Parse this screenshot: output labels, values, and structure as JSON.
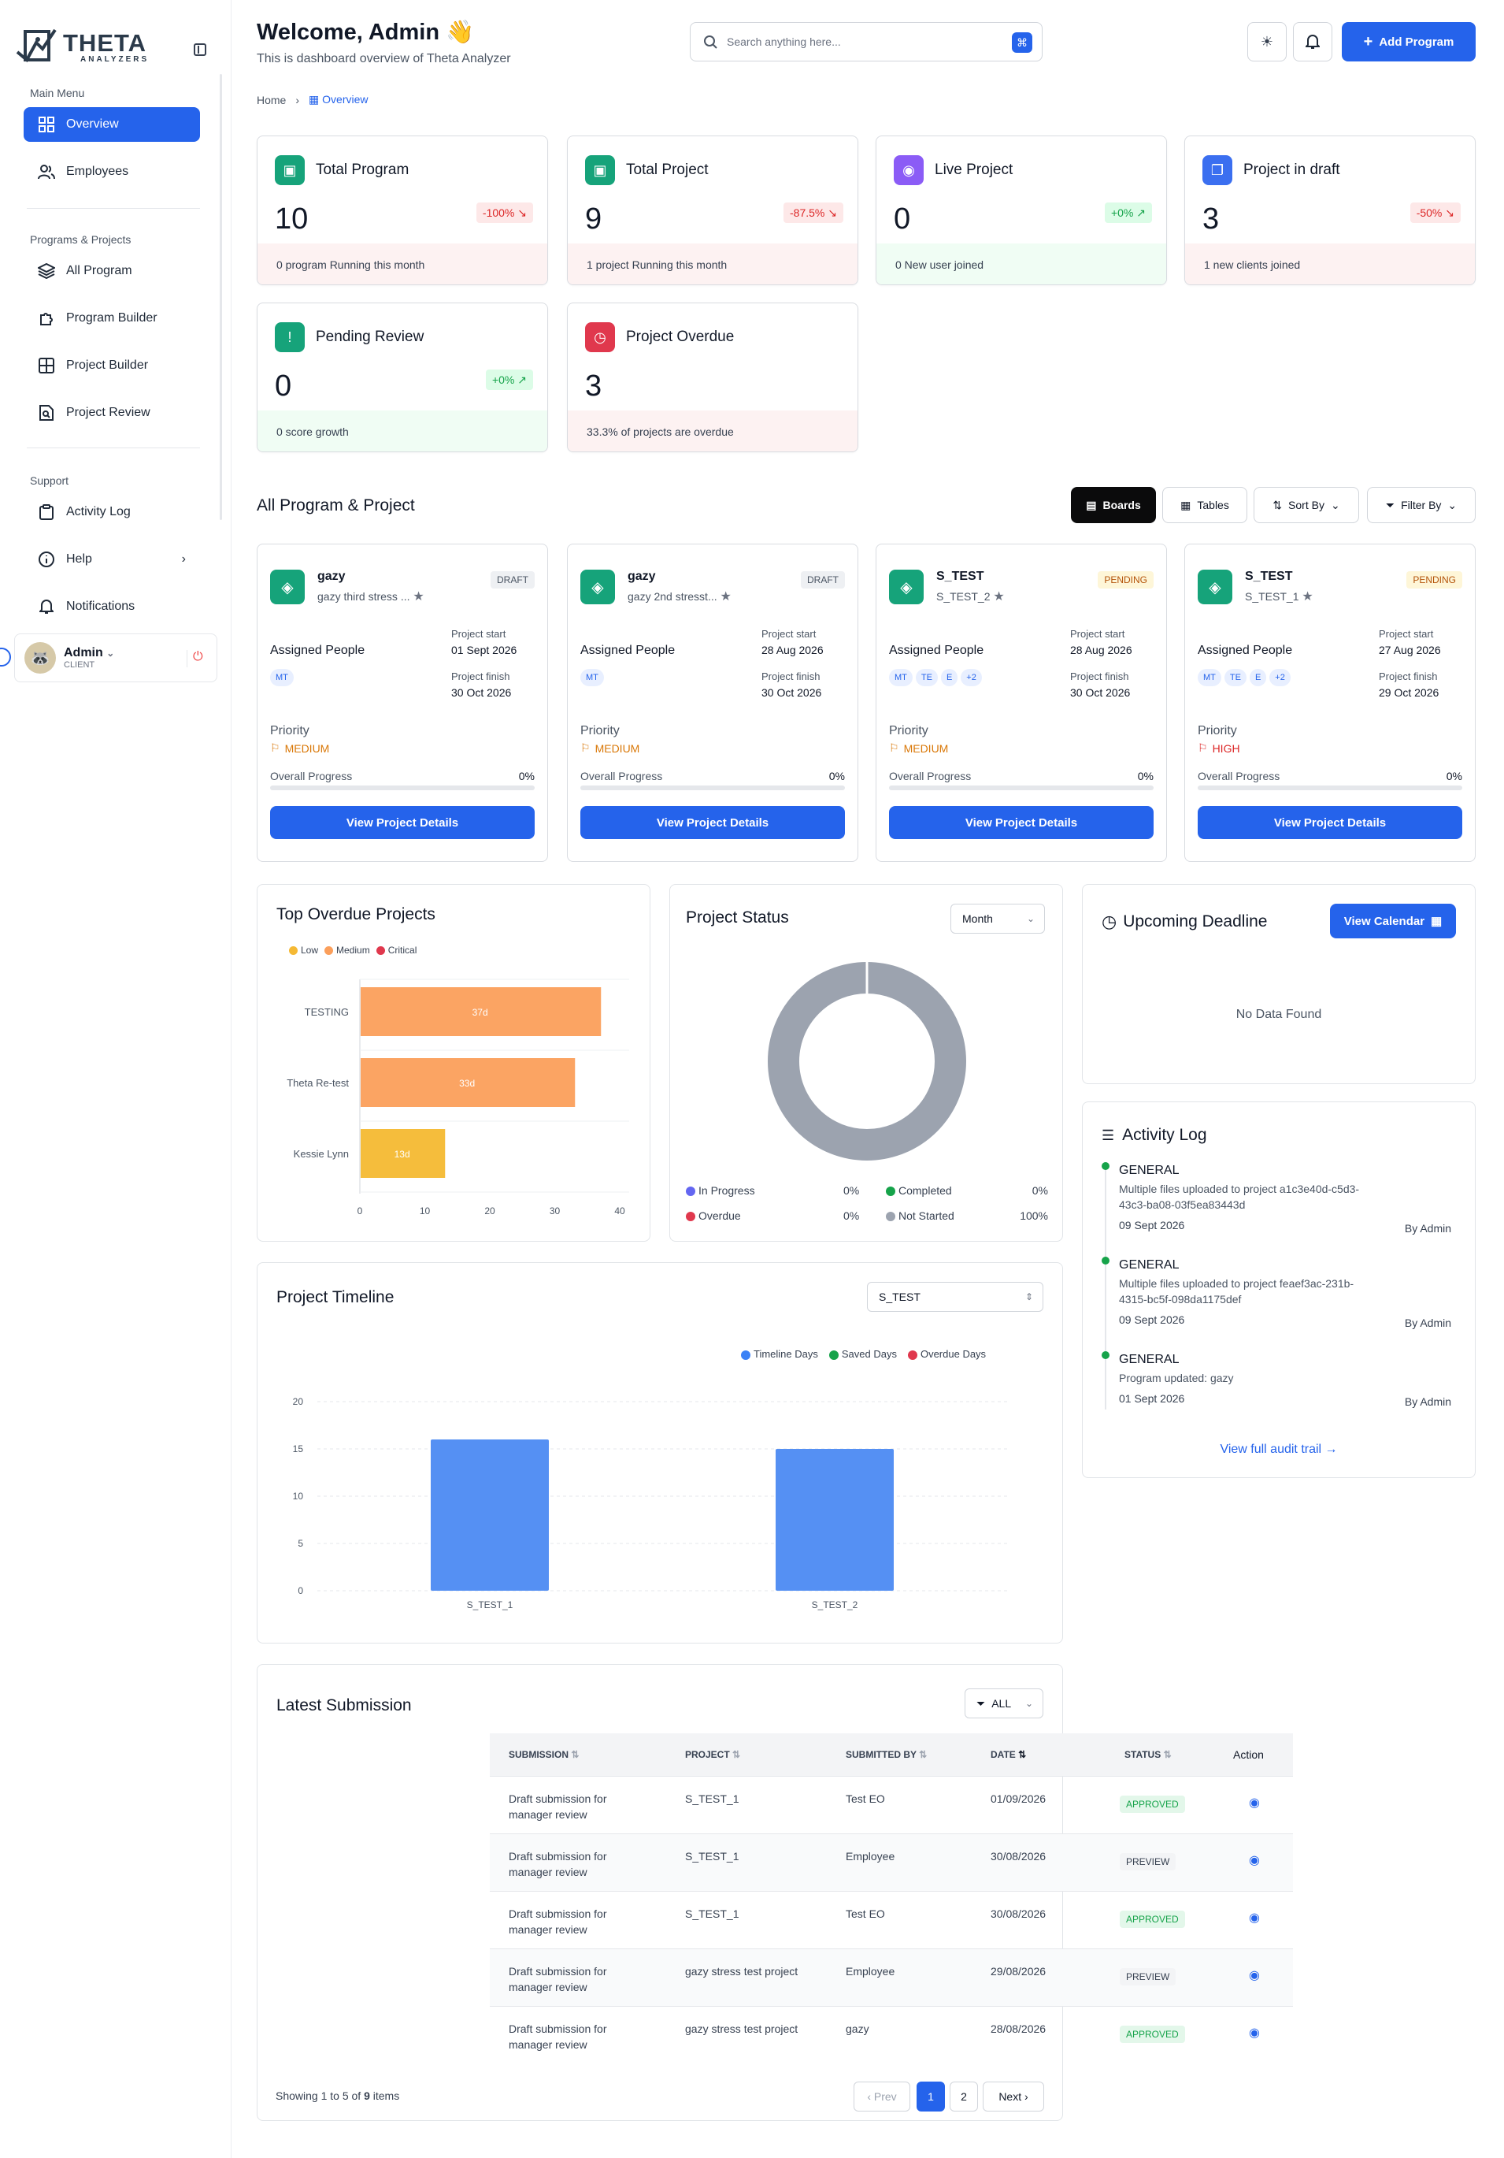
{
  "brand": {
    "name": "THETA",
    "tagline": "ANALYZERS"
  },
  "sidebar": {
    "main_menu_label": "Main Menu",
    "main_items": [
      {
        "label": "Overview",
        "icon": "grid-icon",
        "active": true
      },
      {
        "label": "Employees",
        "icon": "users-icon",
        "active": false
      }
    ],
    "programs_label": "Programs & Projects",
    "program_items": [
      {
        "label": "All Program",
        "icon": "layers-icon"
      },
      {
        "label": "Program Builder",
        "icon": "puzzle-icon"
      },
      {
        "label": "Project Builder",
        "icon": "table-icon"
      },
      {
        "label": "Project Review",
        "icon": "file-search-icon"
      }
    ],
    "support_label": "Support",
    "support_items": [
      {
        "label": "Activity Log",
        "icon": "clipboard-icon"
      },
      {
        "label": "Help",
        "icon": "info-icon"
      },
      {
        "label": "Notifications",
        "icon": "bell-icon"
      }
    ],
    "user": {
      "name": "Admin",
      "role": "CLIENT"
    }
  },
  "header": {
    "title": "Welcome, Admin",
    "title_emoji": "👋",
    "subtitle": "This is dashboard overview of Theta Analyzer",
    "search_placeholder": "Search anything here...",
    "search_shortcut": "⌘",
    "add_button": "Add Program"
  },
  "breadcrumb": {
    "home": "Home",
    "current": "Overview"
  },
  "stats": [
    {
      "title": "Total Program",
      "value": "10",
      "badge": "-100%",
      "trend": "down",
      "footer": "0 program Running this month",
      "icon_color": "#16a37a"
    },
    {
      "title": "Total Project",
      "value": "9",
      "badge": "-87.5%",
      "trend": "down",
      "footer": "1 project Running this month",
      "icon_color": "#16a37a"
    },
    {
      "title": "Live Project",
      "value": "0",
      "badge": "+0%",
      "trend": "up",
      "footer": "0 New user joined",
      "icon_color": "#8b5cf6"
    },
    {
      "title": "Project in draft",
      "value": "3",
      "badge": "-50%",
      "trend": "down",
      "footer": "1 new clients joined",
      "icon_color": "#3b6ff0"
    },
    {
      "title": "Pending Review",
      "value": "0",
      "badge": "+0%",
      "trend": "up",
      "footer": "0 score growth",
      "icon_color": "#16a37a"
    },
    {
      "title": "Project Overdue",
      "value": "3",
      "badge": "",
      "trend": "down",
      "footer": "33.3% of projects are overdue",
      "icon_color": "#e0384d"
    }
  ],
  "programs_section": {
    "title": "All Program & Project",
    "boards": "Boards",
    "tables": "Tables",
    "sort": "Sort By",
    "filter": "Filter By"
  },
  "project_cards": [
    {
      "name": "gazy",
      "desc": "gazy third stress ...",
      "status": "DRAFT",
      "assigned_label": "Assigned People",
      "people": [
        "MT"
      ],
      "start_label": "Project start",
      "start": "01 Sept 2026",
      "finish_label": "Project finish",
      "finish": "30 Oct 2026",
      "priority_label": "Priority",
      "priority": "MEDIUM",
      "progress_label": "Overall Progress",
      "progress": "0%",
      "button": "View Project Details"
    },
    {
      "name": "gazy",
      "desc": "gazy 2nd stresst...",
      "status": "DRAFT",
      "assigned_label": "Assigned People",
      "people": [
        "MT"
      ],
      "start_label": "Project start",
      "start": "28 Aug 2026",
      "finish_label": "Project finish",
      "finish": "30 Oct 2026",
      "priority_label": "Priority",
      "priority": "MEDIUM",
      "progress_label": "Overall Progress",
      "progress": "0%",
      "button": "View Project Details"
    },
    {
      "name": "S_TEST",
      "desc": "S_TEST_2",
      "status": "PENDING",
      "assigned_label": "Assigned People",
      "people": [
        "MT",
        "TE",
        "E",
        "+2"
      ],
      "start_label": "Project start",
      "start": "28 Aug 2026",
      "finish_label": "Project finish",
      "finish": "30 Oct 2026",
      "priority_label": "Priority",
      "priority": "MEDIUM",
      "progress_label": "Overall Progress",
      "progress": "0%",
      "button": "View Project Details"
    },
    {
      "name": "S_TEST",
      "desc": "S_TEST_1",
      "status": "PENDING",
      "assigned_label": "Assigned People",
      "people": [
        "MT",
        "TE",
        "E",
        "+2"
      ],
      "start_label": "Project start",
      "start": "27 Aug 2026",
      "finish_label": "Project finish",
      "finish": "29 Oct 2026",
      "priority_label": "Priority",
      "priority": "HIGH",
      "progress_label": "Overall Progress",
      "progress": "0%",
      "button": "View Project Details"
    }
  ],
  "overdue": {
    "title": "Top Overdue Projects",
    "legend": [
      {
        "label": "Low",
        "color": "#f5b934"
      },
      {
        "label": "Medium",
        "color": "#fb9f5b"
      },
      {
        "label": "Critical",
        "color": "#e0384d"
      }
    ]
  },
  "status_panel": {
    "title": "Project Status",
    "period": "Month",
    "legend": [
      {
        "label": "In Progress",
        "value": "0%",
        "color": "#6366f1"
      },
      {
        "label": "Completed",
        "value": "0%",
        "color": "#16a34a"
      },
      {
        "label": "Overdue",
        "value": "0%",
        "color": "#e0384d"
      },
      {
        "label": "Not Started",
        "value": "100%",
        "color": "#9ca3af"
      }
    ]
  },
  "deadline": {
    "title": "Upcoming Deadline",
    "button": "View Calendar",
    "empty": "No Data Found"
  },
  "activity": {
    "title": "Activity Log",
    "items": [
      {
        "type": "GENERAL",
        "desc": "Multiple files uploaded to project a1c3e40d-c5d3-43c3-ba08-03f5ea83443d",
        "date": "09 Sept 2026",
        "by": "By Admin"
      },
      {
        "type": "GENERAL",
        "desc": "Multiple files uploaded to project feaef3ac-231b-4315-bc5f-098da1175def",
        "date": "09 Sept 2026",
        "by": "By Admin"
      },
      {
        "type": "GENERAL",
        "desc": "Program updated: gazy",
        "date": "01 Sept 2026",
        "by": "By Admin"
      }
    ],
    "link": "View full audit trail"
  },
  "timeline": {
    "title": "Project Timeline",
    "selected": "S_TEST",
    "legend": [
      {
        "label": "Timeline Days",
        "color": "#3b82f6"
      },
      {
        "label": "Saved Days",
        "color": "#16a34a"
      },
      {
        "label": "Overdue Days",
        "color": "#e0384d"
      }
    ]
  },
  "submissions": {
    "title": "Latest Submission",
    "filter": "ALL",
    "columns": [
      "SUBMISSION",
      "PROJECT",
      "SUBMITTED BY",
      "DATE",
      "STATUS",
      "Action"
    ],
    "rows": [
      {
        "submission": "Draft submission for manager review",
        "project": "S_TEST_1",
        "by": "Test EO",
        "date": "01/09/2026",
        "status": "APPROVED"
      },
      {
        "submission": "Draft submission for manager review",
        "project": "S_TEST_1",
        "by": "Employee",
        "date": "30/08/2026",
        "status": "PREVIEW"
      },
      {
        "submission": "Draft submission for manager review",
        "project": "S_TEST_1",
        "by": "Test EO",
        "date": "30/08/2026",
        "status": "APPROVED"
      },
      {
        "submission": "Draft submission for manager review",
        "project": "gazy stress test project",
        "by": "Employee",
        "date": "29/08/2026",
        "status": "PREVIEW"
      },
      {
        "submission": "Draft submission for manager review",
        "project": "gazy stress test project",
        "by": "gazy",
        "date": "28/08/2026",
        "status": "APPROVED"
      }
    ],
    "showing_prefix": "Showing 1 to 5 of",
    "showing_total": "9",
    "showing_suffix": "items",
    "prev": "Prev",
    "pages": [
      "1",
      "2"
    ],
    "next": "Next"
  },
  "chart_data": [
    {
      "type": "bar",
      "orientation": "horizontal",
      "title": "Top Overdue Projects",
      "categories": [
        "TESTING",
        "Theta Re-test",
        "Kessie Lynn"
      ],
      "values": [
        37,
        33,
        13
      ],
      "data_labels": [
        "37d",
        "33d",
        "13d"
      ],
      "bar_colors": [
        "#fba463",
        "#fba463",
        "#f5bd3c"
      ],
      "xlim": [
        0,
        40
      ],
      "xticks": [
        0,
        10,
        20,
        30,
        40
      ],
      "legend": [
        "Low",
        "Medium",
        "Critical"
      ]
    },
    {
      "type": "pie",
      "title": "Project Status",
      "donut": true,
      "categories": [
        "In Progress",
        "Completed",
        "Overdue",
        "Not Started"
      ],
      "values": [
        0,
        0,
        0,
        100
      ],
      "colors": [
        "#6366f1",
        "#16a34a",
        "#e0384d",
        "#9ca3af"
      ]
    },
    {
      "type": "bar",
      "title": "Project Timeline",
      "categories": [
        "S_TEST_1",
        "S_TEST_2"
      ],
      "series": [
        {
          "name": "Timeline Days",
          "values": [
            16,
            15
          ],
          "color": "#5590f3"
        },
        {
          "name": "Saved Days",
          "values": [
            0,
            0
          ],
          "color": "#16a34a"
        },
        {
          "name": "Overdue Days",
          "values": [
            0,
            0
          ],
          "color": "#e0384d"
        }
      ],
      "ylim": [
        0,
        20
      ],
      "yticks": [
        0,
        5,
        10,
        15,
        20
      ],
      "grid": true
    }
  ]
}
